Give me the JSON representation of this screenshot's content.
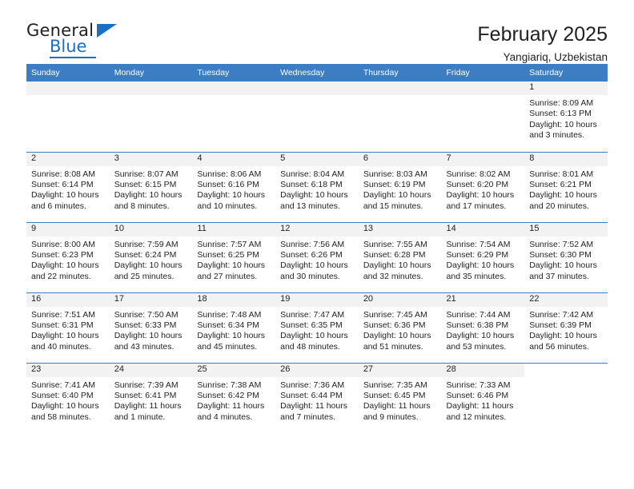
{
  "logo": {
    "word_one": "General",
    "word_two": "Blue",
    "triangle": "triangle-icon"
  },
  "header": {
    "title": "February 2025",
    "subtitle": "Yangiariq, Uzbekistan"
  },
  "colors": {
    "header_blue": "#3c7dc4",
    "brand_blue": "#1b6ec2",
    "band_gray": "#f2f2f2",
    "text": "#231f20"
  },
  "weekdays": [
    "Sunday",
    "Monday",
    "Tuesday",
    "Wednesday",
    "Thursday",
    "Friday",
    "Saturday"
  ],
  "weeks": [
    [
      {
        "day": "",
        "blank": true
      },
      {
        "day": "",
        "blank": true
      },
      {
        "day": "",
        "blank": true
      },
      {
        "day": "",
        "blank": true
      },
      {
        "day": "",
        "blank": true
      },
      {
        "day": "",
        "blank": true
      },
      {
        "day": "1",
        "sunrise": "Sunrise: 8:09 AM",
        "sunset": "Sunset: 6:13 PM",
        "daylight": "Daylight: 10 hours and 3 minutes."
      }
    ],
    [
      {
        "day": "2",
        "sunrise": "Sunrise: 8:08 AM",
        "sunset": "Sunset: 6:14 PM",
        "daylight": "Daylight: 10 hours and 6 minutes."
      },
      {
        "day": "3",
        "sunrise": "Sunrise: 8:07 AM",
        "sunset": "Sunset: 6:15 PM",
        "daylight": "Daylight: 10 hours and 8 minutes."
      },
      {
        "day": "4",
        "sunrise": "Sunrise: 8:06 AM",
        "sunset": "Sunset: 6:16 PM",
        "daylight": "Daylight: 10 hours and 10 minutes."
      },
      {
        "day": "5",
        "sunrise": "Sunrise: 8:04 AM",
        "sunset": "Sunset: 6:18 PM",
        "daylight": "Daylight: 10 hours and 13 minutes."
      },
      {
        "day": "6",
        "sunrise": "Sunrise: 8:03 AM",
        "sunset": "Sunset: 6:19 PM",
        "daylight": "Daylight: 10 hours and 15 minutes."
      },
      {
        "day": "7",
        "sunrise": "Sunrise: 8:02 AM",
        "sunset": "Sunset: 6:20 PM",
        "daylight": "Daylight: 10 hours and 17 minutes."
      },
      {
        "day": "8",
        "sunrise": "Sunrise: 8:01 AM",
        "sunset": "Sunset: 6:21 PM",
        "daylight": "Daylight: 10 hours and 20 minutes."
      }
    ],
    [
      {
        "day": "9",
        "sunrise": "Sunrise: 8:00 AM",
        "sunset": "Sunset: 6:23 PM",
        "daylight": "Daylight: 10 hours and 22 minutes."
      },
      {
        "day": "10",
        "sunrise": "Sunrise: 7:59 AM",
        "sunset": "Sunset: 6:24 PM",
        "daylight": "Daylight: 10 hours and 25 minutes."
      },
      {
        "day": "11",
        "sunrise": "Sunrise: 7:57 AM",
        "sunset": "Sunset: 6:25 PM",
        "daylight": "Daylight: 10 hours and 27 minutes."
      },
      {
        "day": "12",
        "sunrise": "Sunrise: 7:56 AM",
        "sunset": "Sunset: 6:26 PM",
        "daylight": "Daylight: 10 hours and 30 minutes."
      },
      {
        "day": "13",
        "sunrise": "Sunrise: 7:55 AM",
        "sunset": "Sunset: 6:28 PM",
        "daylight": "Daylight: 10 hours and 32 minutes."
      },
      {
        "day": "14",
        "sunrise": "Sunrise: 7:54 AM",
        "sunset": "Sunset: 6:29 PM",
        "daylight": "Daylight: 10 hours and 35 minutes."
      },
      {
        "day": "15",
        "sunrise": "Sunrise: 7:52 AM",
        "sunset": "Sunset: 6:30 PM",
        "daylight": "Daylight: 10 hours and 37 minutes."
      }
    ],
    [
      {
        "day": "16",
        "sunrise": "Sunrise: 7:51 AM",
        "sunset": "Sunset: 6:31 PM",
        "daylight": "Daylight: 10 hours and 40 minutes."
      },
      {
        "day": "17",
        "sunrise": "Sunrise: 7:50 AM",
        "sunset": "Sunset: 6:33 PM",
        "daylight": "Daylight: 10 hours and 43 minutes."
      },
      {
        "day": "18",
        "sunrise": "Sunrise: 7:48 AM",
        "sunset": "Sunset: 6:34 PM",
        "daylight": "Daylight: 10 hours and 45 minutes."
      },
      {
        "day": "19",
        "sunrise": "Sunrise: 7:47 AM",
        "sunset": "Sunset: 6:35 PM",
        "daylight": "Daylight: 10 hours and 48 minutes."
      },
      {
        "day": "20",
        "sunrise": "Sunrise: 7:45 AM",
        "sunset": "Sunset: 6:36 PM",
        "daylight": "Daylight: 10 hours and 51 minutes."
      },
      {
        "day": "21",
        "sunrise": "Sunrise: 7:44 AM",
        "sunset": "Sunset: 6:38 PM",
        "daylight": "Daylight: 10 hours and 53 minutes."
      },
      {
        "day": "22",
        "sunrise": "Sunrise: 7:42 AM",
        "sunset": "Sunset: 6:39 PM",
        "daylight": "Daylight: 10 hours and 56 minutes."
      }
    ],
    [
      {
        "day": "23",
        "sunrise": "Sunrise: 7:41 AM",
        "sunset": "Sunset: 6:40 PM",
        "daylight": "Daylight: 10 hours and 58 minutes."
      },
      {
        "day": "24",
        "sunrise": "Sunrise: 7:39 AM",
        "sunset": "Sunset: 6:41 PM",
        "daylight": "Daylight: 11 hours and 1 minute."
      },
      {
        "day": "25",
        "sunrise": "Sunrise: 7:38 AM",
        "sunset": "Sunset: 6:42 PM",
        "daylight": "Daylight: 11 hours and 4 minutes."
      },
      {
        "day": "26",
        "sunrise": "Sunrise: 7:36 AM",
        "sunset": "Sunset: 6:44 PM",
        "daylight": "Daylight: 11 hours and 7 minutes."
      },
      {
        "day": "27",
        "sunrise": "Sunrise: 7:35 AM",
        "sunset": "Sunset: 6:45 PM",
        "daylight": "Daylight: 11 hours and 9 minutes."
      },
      {
        "day": "28",
        "sunrise": "Sunrise: 7:33 AM",
        "sunset": "Sunset: 6:46 PM",
        "daylight": "Daylight: 11 hours and 12 minutes."
      },
      {
        "day": "",
        "void": true
      }
    ]
  ]
}
